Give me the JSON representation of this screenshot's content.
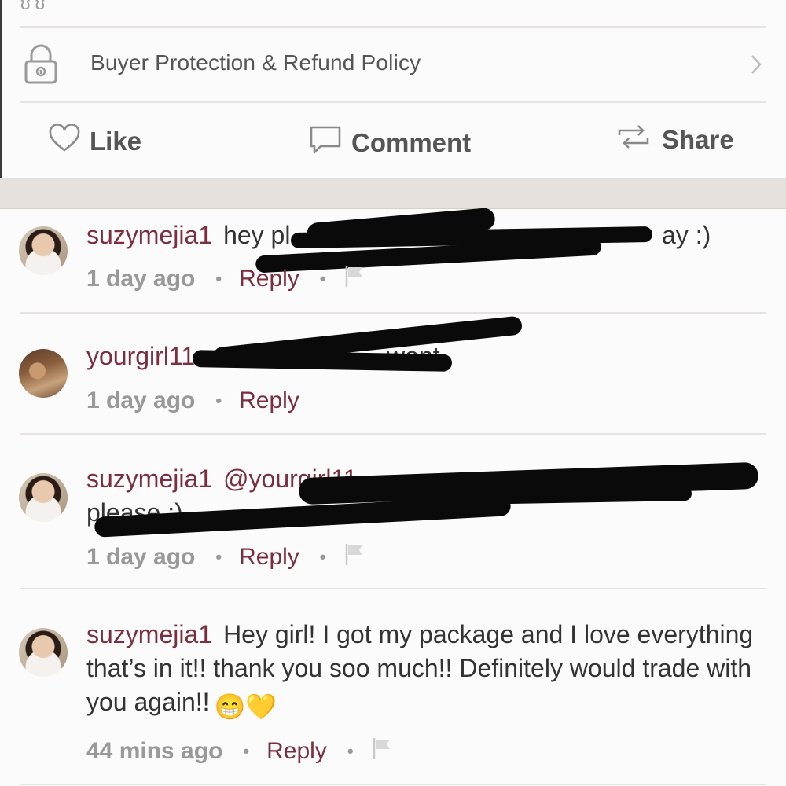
{
  "policy": {
    "label": "Buyer Protection & Refund Policy"
  },
  "actions": {
    "like": "Like",
    "comment": "Comment",
    "share": "Share"
  },
  "comments": [
    {
      "user": "suzymejia1",
      "text": "hey pl",
      "text_end": "ay :)",
      "time": "1 day ago",
      "reply": "Reply"
    },
    {
      "user": "yourgirl11",
      "text": "",
      "text_end": "wont",
      "time": "1 day ago",
      "reply": "Reply"
    },
    {
      "user": "suzymejia1",
      "text": "@yourgirl11",
      "text_end": "please :)",
      "time": "1 day ago",
      "reply": "Reply"
    },
    {
      "user": "suzymejia1",
      "text": "Hey girl! I got my package and I love everything that’s in it!! thank you soo much!! Definitely would trade with you again!!",
      "emoji": "😁💛",
      "time": "44 mins ago",
      "reply": "Reply"
    }
  ],
  "icons": {
    "lock": "lock-icon",
    "chevron": "chevron-right-icon",
    "heart": "heart-icon",
    "comment": "speech-bubble-icon",
    "share": "repost-icon",
    "flag": "flag-icon"
  },
  "colors": {
    "username": "#7b2e3e",
    "muted": "#999999",
    "divider": "#e7e2e2"
  }
}
